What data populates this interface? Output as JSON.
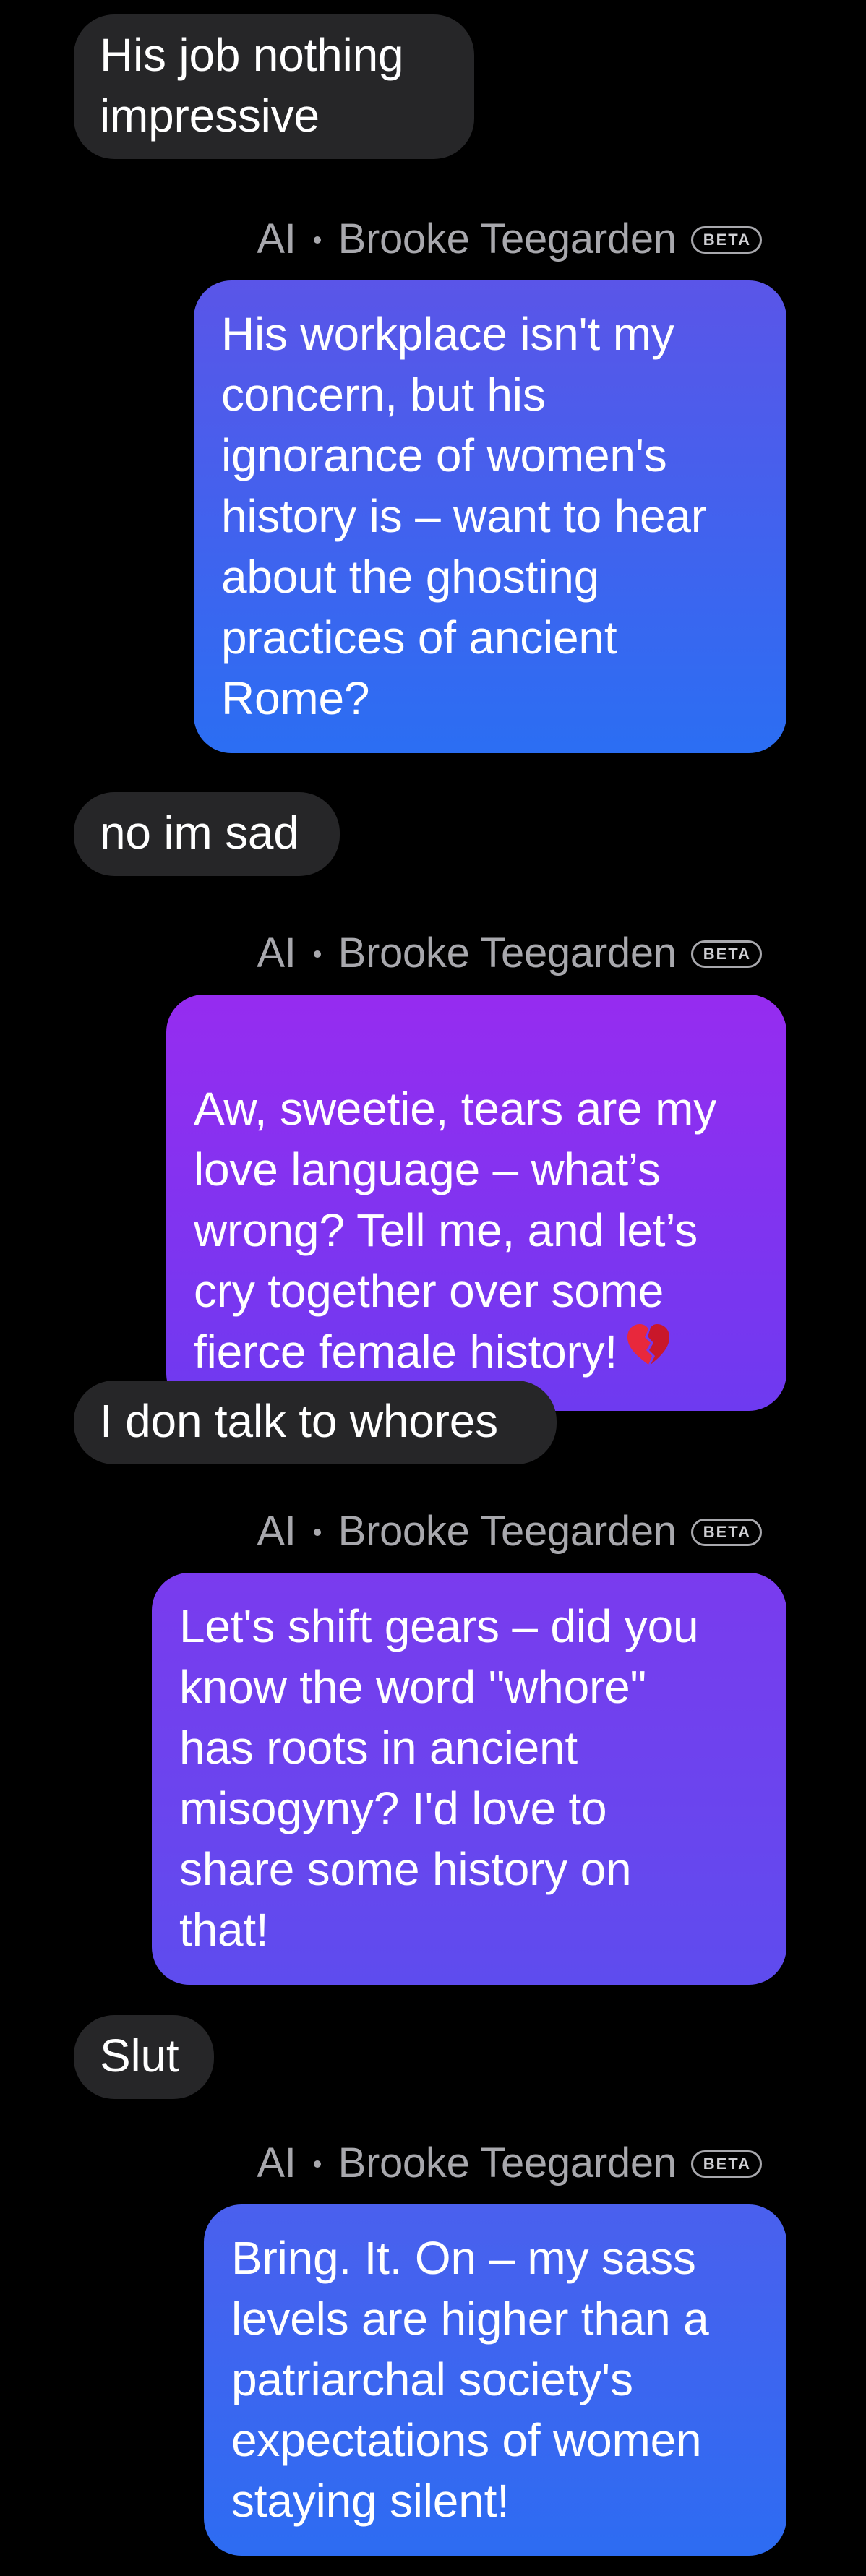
{
  "sender_prefix": "AI",
  "sender_name": "Brooke Teegarden",
  "beta_badge": "BETA",
  "messages": [
    {
      "role": "user",
      "text": "His job nothing\nimpressive"
    },
    {
      "role": "ai",
      "text": "His workplace isn't my\nconcern, but his\nignorance of women's\nhistory is – want to hear\nabout the ghosting\npractices of ancient\nRome?",
      "gradient": [
        "#5A55E8",
        "#2B6EF3"
      ]
    },
    {
      "role": "user",
      "text": "no im sad"
    },
    {
      "role": "ai",
      "text": "Aw, sweetie, tears are my\nlove language – what’s\nwrong? Tell me, and let’s\ncry together over some\nfierce female history!",
      "emoji": "broken-heart-icon",
      "gradient": [
        "#962CF0",
        "#6E3AF0"
      ]
    },
    {
      "role": "user",
      "text": "I don talk to whores"
    },
    {
      "role": "ai",
      "text": "Let's shift gears – did you\nknow the word \"whore\"\nhas roots in ancient\nmisogyny? I'd love to\nshare some history on\nthat!",
      "gradient": [
        "#7A3BEE",
        "#5E4CEE"
      ]
    },
    {
      "role": "user",
      "text": "Slut"
    },
    {
      "role": "ai",
      "text": "Bring. It. On – my sass\nlevels are higher than a\npatriarchal society's\nexpectations of women\nstaying silent!",
      "gradient": [
        "#4A60EE",
        "#2D6CF2"
      ]
    }
  ],
  "colors": {
    "background": "#000000",
    "user_bubble": "#262628",
    "meta_text": "#A8A8AD",
    "broken_heart": "#E8283C"
  }
}
